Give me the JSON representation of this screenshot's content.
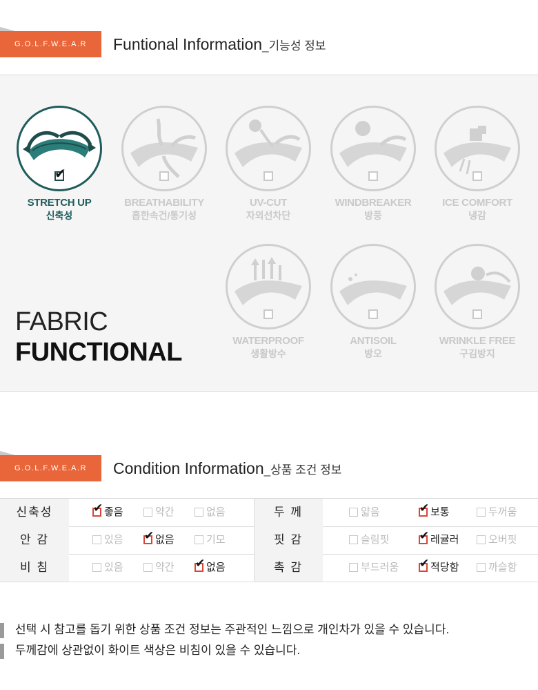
{
  "section1": {
    "badge": "G.O.L.F.W.E.A.R",
    "title_en": "Funtional Information",
    "title_ko": "_기능성 정보"
  },
  "fabric_title": {
    "line1": "FABRIC",
    "line2": "FUNCTIONAL"
  },
  "functions": [
    {
      "en": "STRETCH UP",
      "ko": "신축성",
      "checked": true
    },
    {
      "en": "BREATHABILITY",
      "ko": "흡한속건/통기성",
      "checked": false
    },
    {
      "en": "UV-CUT",
      "ko": "자외선차단",
      "checked": false
    },
    {
      "en": "WINDBREAKER",
      "ko": "방풍",
      "checked": false
    },
    {
      "en": "ICE COMFORT",
      "ko": "냉감",
      "checked": false
    },
    {
      "en": "WATERPROOF",
      "ko": "생활방수",
      "checked": false
    },
    {
      "en": "ANTISOIL",
      "ko": "방오",
      "checked": false
    },
    {
      "en": "WRINKLE FREE",
      "ko": "구김방지",
      "checked": false
    }
  ],
  "section2": {
    "badge": "G.O.L.F.W.E.A.R",
    "title_en": "Condition Information",
    "title_ko": "_상품 조건 정보"
  },
  "conditions": {
    "left": [
      {
        "label": "신축성",
        "options": [
          "좋음",
          "약간",
          "없음"
        ],
        "selected": 0
      },
      {
        "label": "안  감",
        "options": [
          "있음",
          "없음",
          "기모"
        ],
        "selected": 1
      },
      {
        "label": "비  침",
        "options": [
          "있음",
          "약간",
          "없음"
        ],
        "selected": 2
      }
    ],
    "right": [
      {
        "label": "두  께",
        "options": [
          "얇음",
          "보통",
          "두꺼움"
        ],
        "selected": 1
      },
      {
        "label": "핏  감",
        "options": [
          "슬림핏",
          "레귤러",
          "오버핏"
        ],
        "selected": 1
      },
      {
        "label": "촉  감",
        "options": [
          "부드러움",
          "적당함",
          "까슬함"
        ],
        "selected": 1
      }
    ]
  },
  "notes": [
    "선택 시 참고를 돕기 위한 상품 조건 정보는 주관적인 느낌으로 개인차가 있을 수 있습니다.",
    "두께감에 상관없이 화이트 색상은 비침이 있을 수 있습니다."
  ],
  "colors": {
    "accent": "#e8663a",
    "active": "#1e5d5b",
    "inactive": "#c9c9c9",
    "check_box": "#d8453a"
  }
}
